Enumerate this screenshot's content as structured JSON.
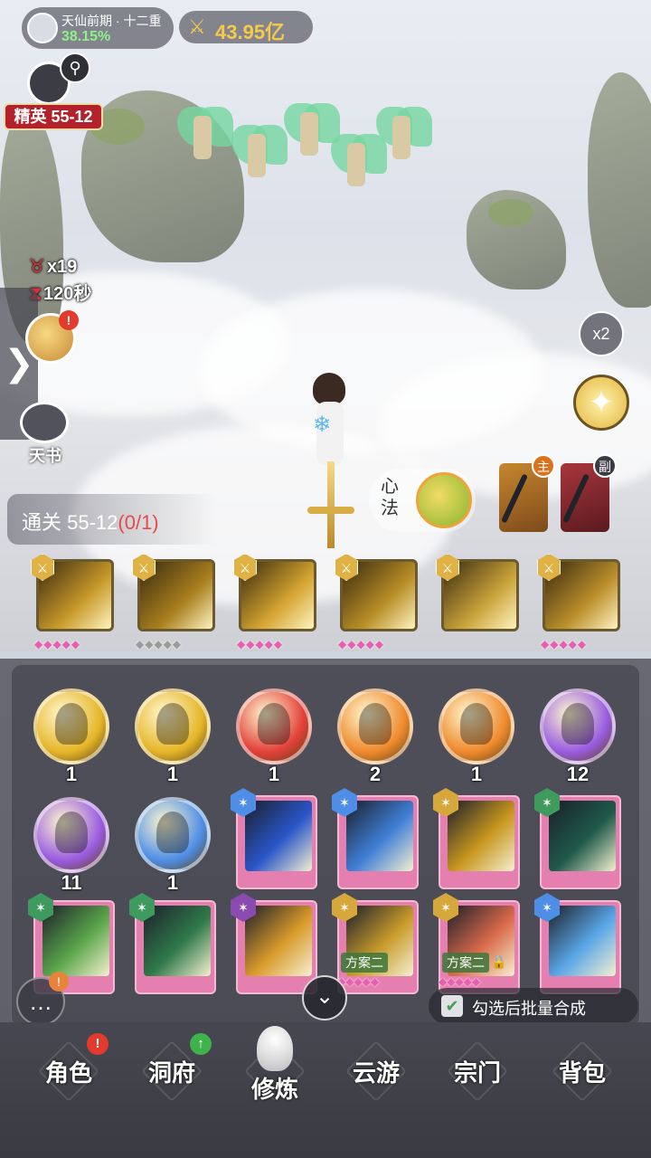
{
  "colors": {
    "accent_gold": "#f5c94a",
    "realm_pct_green": "#8ef08a",
    "stage_red": "#b3212b",
    "pip_pink": "#e65fb0"
  },
  "status": {
    "realm": "天仙前期 · 十二重",
    "realm_progress": "38.15%",
    "power": "43.95亿",
    "power_icon": "crossed-swords-icon"
  },
  "stage": {
    "tag": "精英 55-12",
    "kills": "x19",
    "timer": "120秒",
    "clear_text": "通关 55-12",
    "clear_progress": "(0/1)"
  },
  "side": {
    "tab_arrow": "❯",
    "tianshu_label": "天书",
    "speed_label": "x2",
    "alert_badge": "!"
  },
  "equip": {
    "xinfa_label": "心法",
    "main_tag": "主",
    "sub_tag": "副"
  },
  "skills": [
    {
      "pips": "◆◆◆◆◆",
      "grey": false,
      "art": "#c99a2a"
    },
    {
      "pips": "◆◆◆◆◆",
      "grey": true,
      "art": "#a87f1e"
    },
    {
      "pips": "◆◆◆◆◆",
      "grey": false,
      "art": "#d4a531"
    },
    {
      "pips": "◆◆◆◆◆",
      "grey": false,
      "art": "#b88e26"
    },
    {
      "pips": "",
      "grey": false,
      "art": "#caa43a"
    },
    {
      "pips": "◆◆◆◆◆",
      "grey": false,
      "art": "#bb8f2b"
    }
  ],
  "inventory": {
    "orbs": [
      {
        "count": "1",
        "color": "#e6b62a"
      },
      {
        "count": "1",
        "color": "#e6b62a"
      },
      {
        "count": "1",
        "color": "#e3413a"
      },
      {
        "count": "2",
        "color": "#ef8a2e"
      },
      {
        "count": "1",
        "color": "#ef8a2e"
      },
      {
        "count": "12",
        "color": "#9a5ce0"
      },
      {
        "count": "11",
        "color": "#9a5ce0"
      },
      {
        "count": "1",
        "color": "#4f8ee6"
      }
    ],
    "cards": [
      {
        "badge": "#4f8ee6",
        "art": "#2a56c9",
        "plan": "",
        "pips": ""
      },
      {
        "badge": "#4f8ee6",
        "art": "#3f7fd6",
        "plan": "",
        "pips": ""
      },
      {
        "badge": "#d6a73a",
        "art": "#c7961e",
        "plan": "",
        "pips": ""
      },
      {
        "badge": "#3f9a5e",
        "art": "#1f5a4a",
        "plan": "",
        "pips": ""
      },
      {
        "badge": "#3f9a5e",
        "art": "#5aa54a",
        "plan": "",
        "pips": ""
      },
      {
        "badge": "#3f9a5e",
        "art": "#2f7a4a",
        "plan": "",
        "pips": ""
      },
      {
        "badge": "#8a4ab0",
        "art": "#d99a2a",
        "plan": "",
        "pips": ""
      },
      {
        "badge": "#d6a73a",
        "art": "#c79a2a",
        "plan": "方案二",
        "pips": "◆◆◆◆◆"
      },
      {
        "badge": "#d6a73a",
        "art": "#d96a4a",
        "plan": "方案二",
        "pips": "◆◆◆◆◆"
      },
      {
        "badge": "#4f8ee6",
        "art": "#5aa6e6",
        "plan": "",
        "pips": ""
      }
    ],
    "batch_merge_label": "勾选后批量合成",
    "batch_check": "✔"
  },
  "nav": [
    {
      "label": "角色",
      "badge": "!",
      "badge_type": "red"
    },
    {
      "label": "洞府",
      "badge": "↑",
      "badge_type": "green"
    },
    {
      "label": "修炼",
      "badge": "",
      "badge_type": ""
    },
    {
      "label": "云游",
      "badge": "",
      "badge_type": ""
    },
    {
      "label": "宗门",
      "badge": "",
      "badge_type": ""
    },
    {
      "label": "背包",
      "badge": "",
      "badge_type": ""
    }
  ]
}
